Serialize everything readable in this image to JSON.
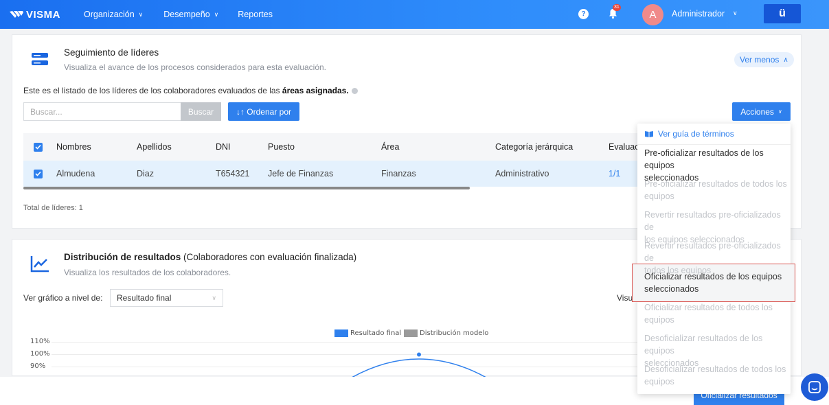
{
  "topbar": {
    "brand": "VISMA",
    "nav": [
      {
        "label": "Organización"
      },
      {
        "label": "Desempeño"
      },
      {
        "label": "Reportes"
      }
    ],
    "notification_count": "31",
    "user_initial": "A",
    "user_name": "Administrador",
    "app_badge": "ü"
  },
  "leaders_section": {
    "title": "Seguimiento de líderes",
    "subtitle": "Visualiza el avance de los procesos considerados para esta evaluación.",
    "toggle_label": "Ver menos",
    "intro_text": "Este es el listado de los líderes de los colaboradores evaluados de las ",
    "intro_bold": "áreas asignadas.",
    "search_placeholder": "Buscar...",
    "search_button": "Buscar",
    "order_button": "↓↑ Ordenar por",
    "actions_button": "Acciones",
    "table": {
      "headers": [
        "Nombres",
        "Apellidos",
        "DNI",
        "Puesto",
        "Área",
        "Categoría jerárquica",
        "Evaluaci"
      ],
      "rows": [
        {
          "nombres": "Almudena",
          "apellidos": "Diaz",
          "dni": "T654321",
          "puesto": "Jefe de Finanzas",
          "area": "Finanzas",
          "categoria": "Administrativo",
          "evaluacion": "1/1"
        }
      ]
    },
    "total_label": "Total de líderes: 1"
  },
  "distribution_section": {
    "title": "Distribución de resultados",
    "title_suffix": " (Colaboradores con evaluación finalizada)",
    "subtitle": "Visualiza los resultados de los colaboradores.",
    "level_label": "Ver gráfico a nivel de:",
    "level_value": "Resultado final",
    "visu_label": "Visual",
    "legend": [
      {
        "name": "Resultado final",
        "color": "#2f80ed"
      },
      {
        "name": "Distribución modelo",
        "color": "#9a9a9a"
      }
    ],
    "y_ticks": [
      "110%",
      "100%",
      "90%"
    ]
  },
  "actions_menu": {
    "guide": "Ver guía de términos",
    "items": [
      {
        "line1": "Pre-oficializar resultados de los equipos",
        "line2": "seleccionados",
        "enabled": true
      },
      {
        "line1": "Pre-oficializar resultados de todos los",
        "line2": "equipos",
        "enabled": false
      },
      {
        "line1": "Revertir resultados pre-oficializados de",
        "line2": "los equipos seleccionados",
        "enabled": false
      },
      {
        "line1": "Revertir resultados pre-oficializados de",
        "line2": "todos los equipos",
        "enabled": false
      },
      {
        "line1": "Oficializar resultados de los equipos",
        "line2": "seleccionados",
        "enabled": true
      },
      {
        "line1": "Oficializar resultados de todos los",
        "line2": "equipos",
        "enabled": false
      },
      {
        "line1": "Desoficializar resultados de los equipos",
        "line2": "seleccionados",
        "enabled": false
      },
      {
        "line1": "Desoficializar resultados de todos los",
        "line2": "equipos",
        "enabled": false
      }
    ]
  },
  "footer": {
    "official_button": "Oficializar resultados"
  }
}
